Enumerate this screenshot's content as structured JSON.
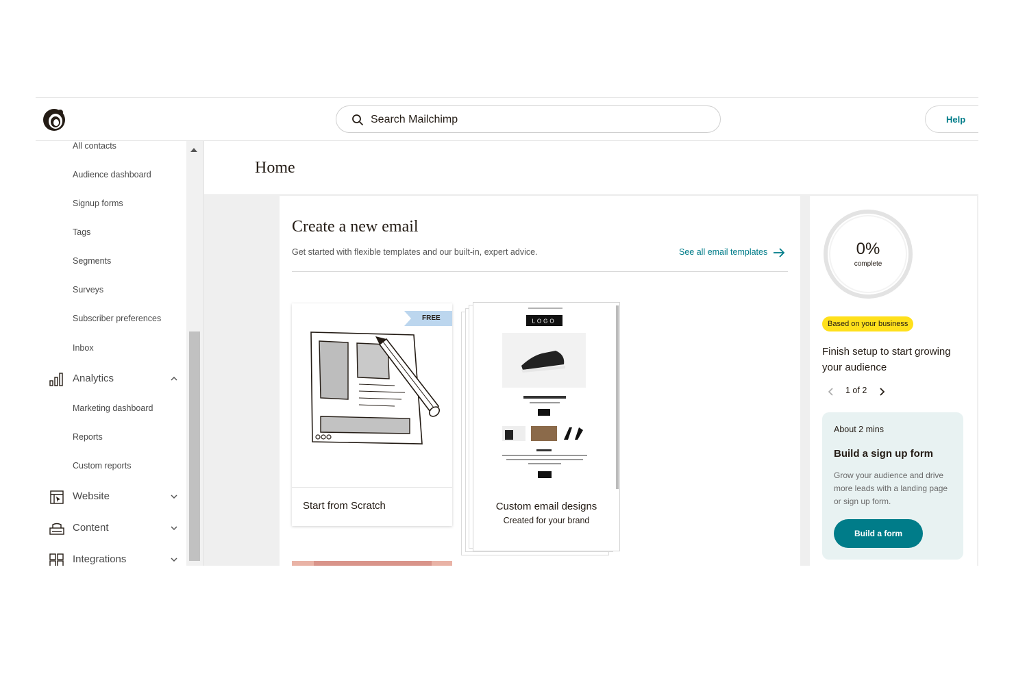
{
  "header": {
    "search_placeholder": "Search Mailchimp",
    "help_label": "Help"
  },
  "sidebar": {
    "audience_items": [
      "All contacts",
      "Audience dashboard",
      "Signup forms",
      "Tags",
      "Segments",
      "Surveys",
      "Subscriber preferences",
      "Inbox"
    ],
    "analytics": {
      "label": "Analytics",
      "items": [
        "Marketing dashboard",
        "Reports",
        "Custom reports"
      ]
    },
    "website_label": "Website",
    "content_label": "Content",
    "integrations_label": "Integrations"
  },
  "main": {
    "page_title": "Home",
    "create_card": {
      "title": "Create a new email",
      "subtitle": "Get started with flexible templates and our built-in, expert advice.",
      "see_all_link": "See all email templates",
      "tiles": [
        {
          "label": "Start from Scratch",
          "badge": "FREE"
        },
        {
          "title": "Custom email designs",
          "subtitle": "Created for your brand"
        }
      ]
    },
    "setup_panel": {
      "progress_value": "0%",
      "progress_label": "complete",
      "progress_fraction": 0,
      "badge": "Based on your business",
      "heading": "Finish setup to start growing your audience",
      "pager": "1 of 2",
      "tip": {
        "duration": "About 2 mins",
        "title": "Build a sign up form",
        "body": "Grow your audience and drive more leads with a landing page or sign up form.",
        "button": "Build a form"
      }
    }
  },
  "colors": {
    "brand_teal": "#007c89",
    "badge_yellow": "#ffe01b",
    "tip_bg": "#e8f2f2",
    "free_badge": "#bcd6ee"
  }
}
